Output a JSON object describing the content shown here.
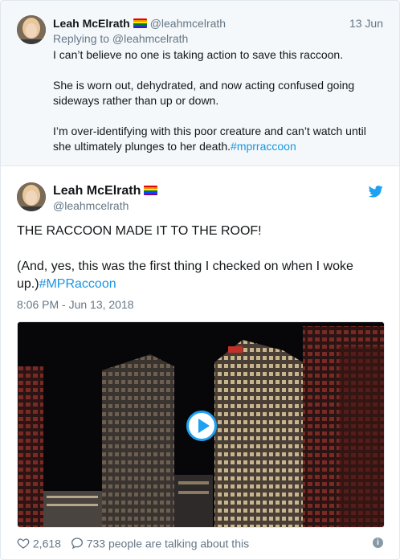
{
  "parent_tweet": {
    "name": "Leah McElrath",
    "handle": "@leahmcelrath",
    "date": "13 Jun",
    "replying_to": "Replying to @leahmcelrath",
    "paragraphs": [
      "I can’t believe no one is taking action to save this raccoon.",
      "She is worn out, dehydrated, and now acting confused going sideways rather than up or down."
    ],
    "last_paragraph": "I’m over-identifying with this poor creature and can’t watch until she ultimately plunges to her death.",
    "hashtag": "#mprraccoon"
  },
  "main_tweet": {
    "name": "Leah McElrath",
    "handle": "@leahmcelrath",
    "line1": "THE RACCOON MADE IT TO THE ROOF!",
    "line2": "(And, yes, this was the first thing I checked on when I woke up.)",
    "hashtag": "#MPRaccoon",
    "timestamp": "8:06 PM - Jun 13, 2018",
    "likes": "2,618",
    "talking": "733 people are talking about this"
  },
  "icons": {
    "brand": "twitter-bird-icon",
    "like": "heart-icon",
    "reply": "speech-bubble-icon",
    "info": "info-icon",
    "media": "play-icon"
  },
  "colors": {
    "link": "#1b95e0",
    "twitter_blue": "#1da1f2",
    "muted": "#657786"
  }
}
